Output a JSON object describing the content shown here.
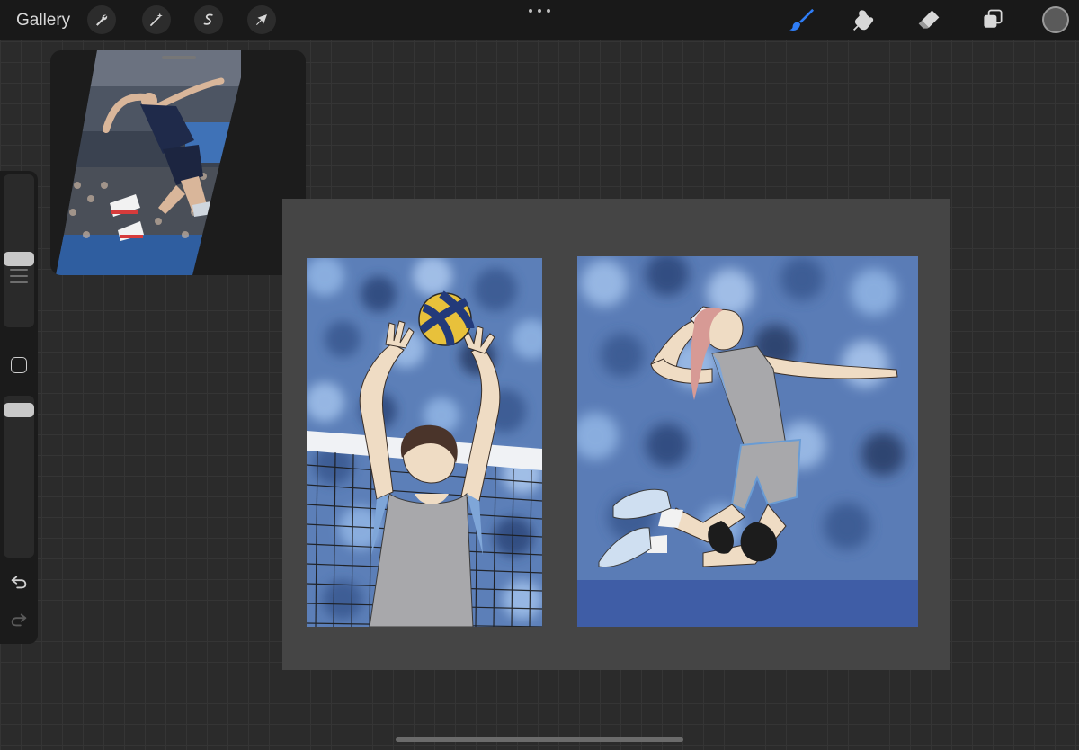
{
  "toolbar": {
    "gallery_label": "Gallery",
    "left_tools": [
      "wrench-icon",
      "magic-wand-icon",
      "selection-icon",
      "transform-arrow-icon"
    ],
    "right_tools": [
      "brush-icon",
      "smudge-icon",
      "eraser-icon",
      "layers-icon"
    ],
    "active_tool": "brush-icon",
    "accent_color": "#2f7df6",
    "current_color": "#5a5a5a"
  },
  "reference_window": {
    "visible": true
  },
  "sidebar": {
    "controls": [
      "brush-size-slider",
      "modify-button",
      "opacity-slider",
      "undo-icon",
      "redo-icon"
    ]
  },
  "canvas": {
    "panels": [
      "setter-panel",
      "spiker-panel"
    ],
    "background_color": "#454545"
  }
}
